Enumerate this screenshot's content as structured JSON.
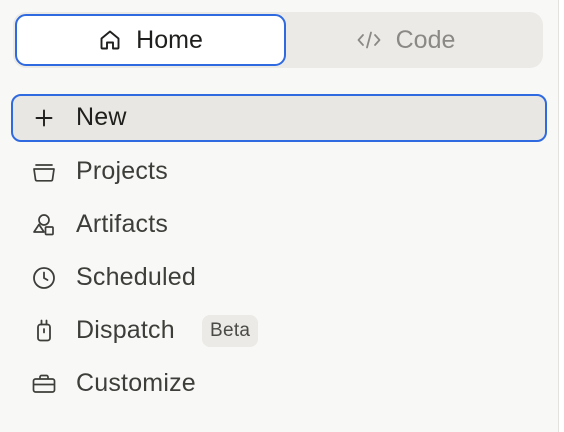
{
  "mode_toggle": {
    "home_label": "Home",
    "code_label": "Code",
    "home_icon": "home-icon",
    "code_icon": "code-icon",
    "selected": "Home"
  },
  "nav": {
    "items": [
      {
        "label": "New",
        "icon": "plus-icon",
        "active": true
      },
      {
        "label": "Projects",
        "icon": "folder-icon"
      },
      {
        "label": "Artifacts",
        "icon": "shapes-icon"
      },
      {
        "label": "Scheduled",
        "icon": "clock-icon"
      },
      {
        "label": "Dispatch",
        "icon": "device-icon",
        "badge": "Beta"
      },
      {
        "label": "Customize",
        "icon": "briefcase-icon"
      }
    ]
  },
  "colors": {
    "focus_ring": "#2f6ae0",
    "background": "#f8f8f6",
    "active_bg": "#e9e7e3",
    "toggle_bg": "#eceae6",
    "badge_bg": "#ebeae6"
  }
}
